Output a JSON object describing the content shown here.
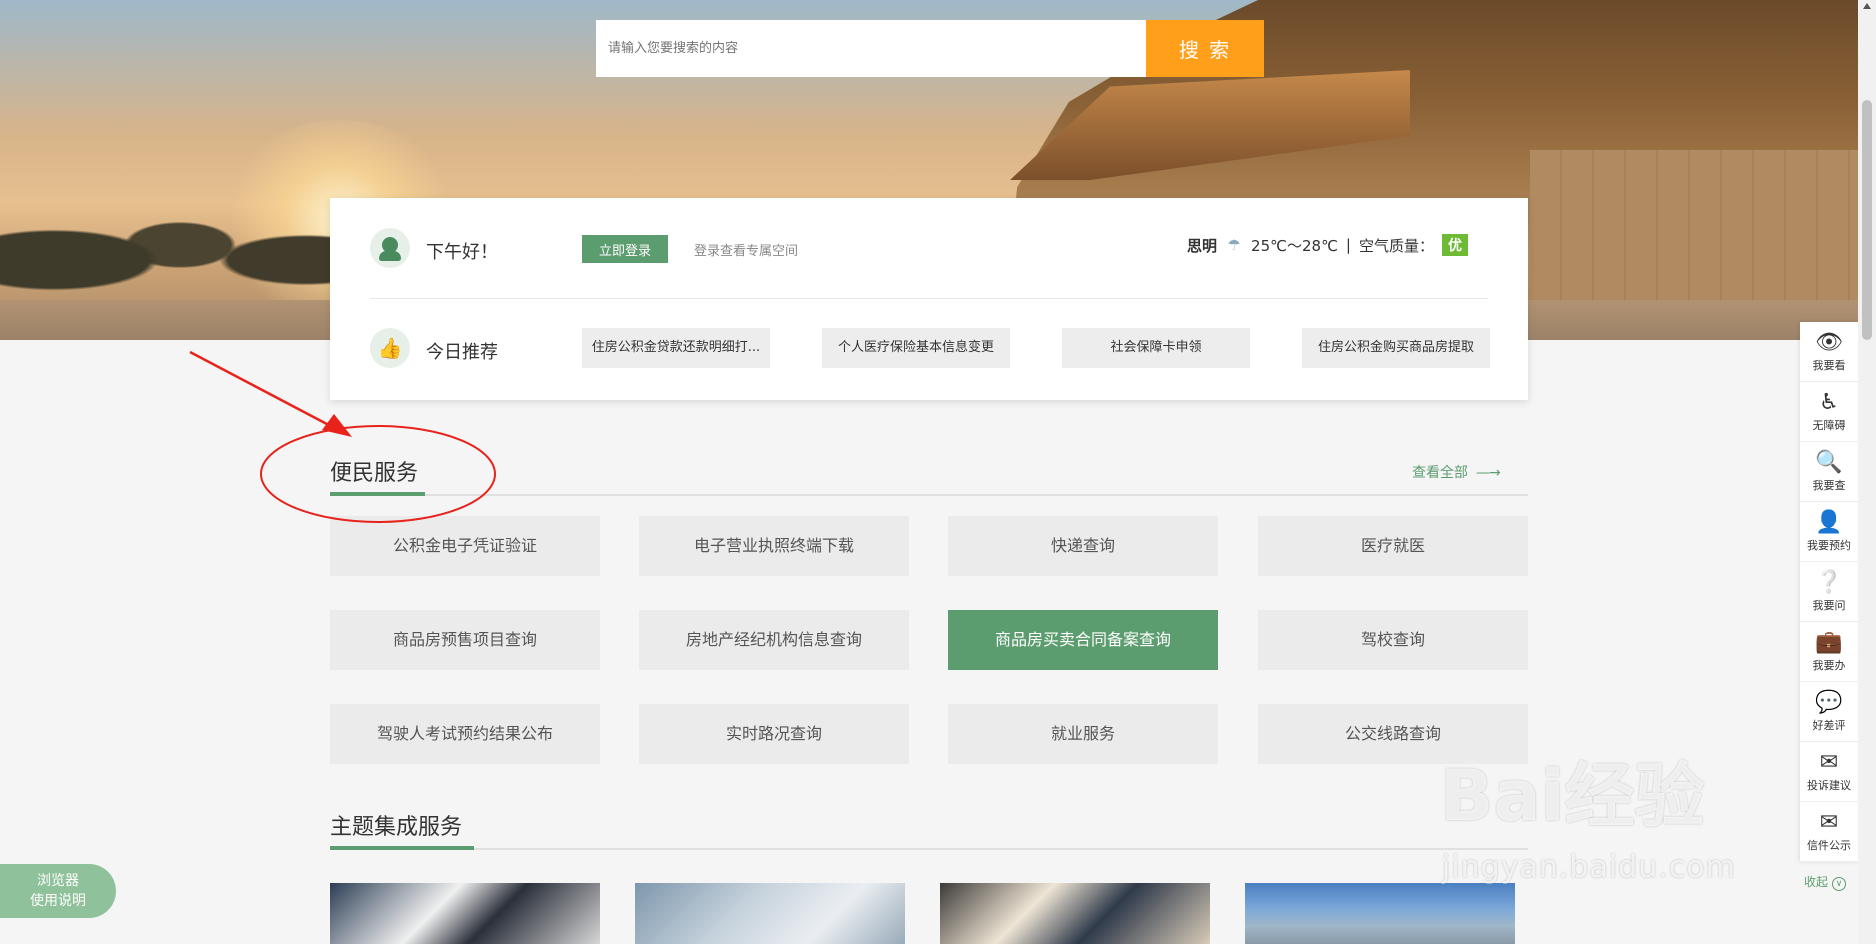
{
  "search": {
    "placeholder": "请输入您要搜索的内容",
    "button": "搜 索"
  },
  "welcome": {
    "greeting": "下午好！",
    "login_button": "立即登录",
    "login_hint": "登录查看专属空间"
  },
  "weather": {
    "city": "思明",
    "icon": "weather-icon",
    "temp": "25℃～28℃",
    "sep": "|",
    "air_label": "空气质量：",
    "air_value": "优",
    "air_color": "#6dbb35"
  },
  "recommend": {
    "title": "今日推荐",
    "items": [
      "住房公积金贷款还款明细打...",
      "个人医疗保险基本信息变更",
      "社会保障卡申领",
      "住房公积金购买商品房提取"
    ]
  },
  "convenience": {
    "title": "便民服务",
    "view_all": "查看全部",
    "items": [
      "公积金电子凭证验证",
      "电子营业执照终端下载",
      "快递查询",
      "医疗就医",
      "商品房预售项目查询",
      "房地产经纪机构信息查询",
      "商品房买卖合同备案查询",
      "驾校查询",
      "驾驶人考试预约结果公布",
      "实时路况查询",
      "就业服务",
      "公交线路查询"
    ],
    "active_item": "商品房买卖合同备案查询"
  },
  "theme": {
    "title": "主题集成服务"
  },
  "sidebar": {
    "items": [
      {
        "icon": "eye-icon",
        "label": "我要看"
      },
      {
        "icon": "accessibility-icon",
        "label": "无障碍"
      },
      {
        "icon": "search-doc-icon",
        "label": "我要查"
      },
      {
        "icon": "user-icon",
        "label": "我要预约"
      },
      {
        "icon": "question-icon",
        "label": "我要问"
      },
      {
        "icon": "briefcase-icon",
        "label": "我要办"
      },
      {
        "icon": "comment-icon",
        "label": "好差评"
      },
      {
        "icon": "mail-icon",
        "label": "投诉建议"
      },
      {
        "icon": "open-mail-icon",
        "label": "信件公示"
      }
    ],
    "collapse": "收起"
  },
  "browser_help": {
    "line1": "浏览器",
    "line2": "使用说明"
  },
  "watermark": {
    "brand": "Bai经验",
    "url": "jingyan.baidu.com"
  },
  "colors": {
    "accent": "#5c9d6f",
    "search_button": "#ff9f1a",
    "annotation": "#e8231b"
  }
}
